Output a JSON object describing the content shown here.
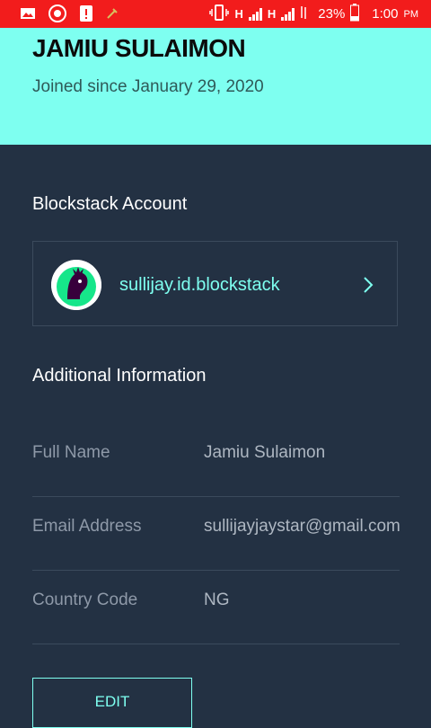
{
  "status_bar": {
    "network_1": "H",
    "network_2": "H",
    "battery": "23%",
    "time": "1:00",
    "ampm": "PM"
  },
  "profile": {
    "name": "JAMIU SULAIMON",
    "joined": "Joined since January 29, 2020"
  },
  "blockstack": {
    "section_title": "Blockstack Account",
    "account_name": "sullijay.id.blockstack"
  },
  "additional": {
    "section_title": "Additional Information",
    "rows": [
      {
        "label": "Full Name",
        "value": "Jamiu Sulaimon"
      },
      {
        "label": "Email Address",
        "value": "sullijayjaystar@gmail.com"
      },
      {
        "label": "Country Code",
        "value": "NG"
      }
    ]
  },
  "actions": {
    "edit_label": "EDIT"
  },
  "colors": {
    "accent": "#7efff0",
    "background": "#233143",
    "status_bar": "#f21c1c"
  }
}
